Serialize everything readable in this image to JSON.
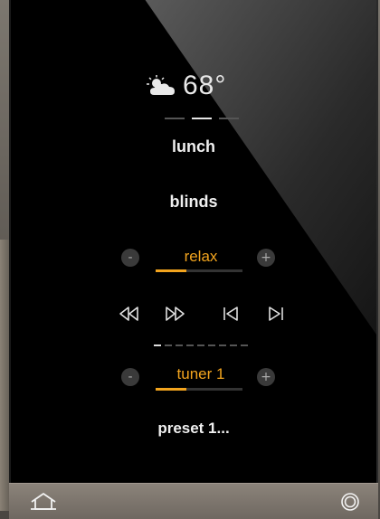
{
  "weather": {
    "icon": "partly-cloudy-icon",
    "temperature": "68°"
  },
  "scene": {
    "label": "lunch",
    "page_dots_count": 3,
    "page_dots_active": 1
  },
  "shades": {
    "label": "blinds"
  },
  "mood": {
    "label": "relax",
    "level": 0.35,
    "minus_label": "-",
    "plus_label": "+"
  },
  "transport": {
    "rewind_icon": "rewind-icon",
    "fast_forward_icon": "fast-forward-icon",
    "previous_icon": "skip-previous-icon",
    "next_icon": "skip-next-icon"
  },
  "track_dots": {
    "count": 9,
    "active": 0
  },
  "source": {
    "label": "tuner 1",
    "level": 0.35,
    "minus_label": "-",
    "plus_label": "+"
  },
  "preset": {
    "label": "preset 1..."
  },
  "bottom_bar": {
    "home_icon": "home-icon",
    "settings_icon": "ring-icon"
  },
  "colors": {
    "accent": "#f2a41e",
    "text": "#f0f0f0",
    "panel": "#000000"
  }
}
